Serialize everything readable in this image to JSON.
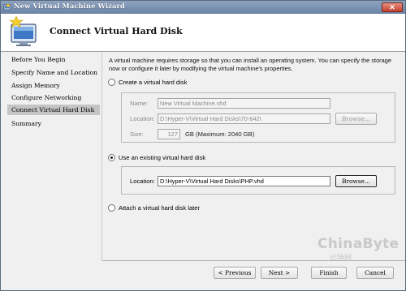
{
  "window": {
    "title": "New Virtual Machine Wizard",
    "close_label": "✕"
  },
  "header": {
    "page_title": "Connect Virtual Hard Disk"
  },
  "nav": {
    "items": [
      {
        "label": "Before You Begin",
        "selected": false
      },
      {
        "label": "Specify Name and Location",
        "selected": false
      },
      {
        "label": "Assign Memory",
        "selected": false
      },
      {
        "label": "Configure Networking",
        "selected": false
      },
      {
        "label": "Connect Virtual Hard Disk",
        "selected": true
      },
      {
        "label": "Summary",
        "selected": false
      }
    ]
  },
  "content": {
    "intro": "A virtual machine requires storage so that you can install an operating system. You can specify the storage now or configure it later by modifying the virtual machine's properties.",
    "option_create": {
      "label": "Create a virtual hard disk",
      "checked": false,
      "name_label": "Name:",
      "name_value": "New Virtual Machine.vhd",
      "location_label": "Location:",
      "location_value": "D:\\Hyper-V\\Virtual Hard Disks\\70-642\\",
      "browse_label": "Browse...",
      "size_label": "Size:",
      "size_value": "127",
      "size_suffix": "GB (Maximum: 2040 GB)"
    },
    "option_existing": {
      "label": "Use an existing virtual hard disk",
      "checked": true,
      "location_label": "Location:",
      "location_value": "D:\\Hyper-V\\Virtual Hard Disks\\PHP.vhd",
      "browse_label": "Browse..."
    },
    "option_later": {
      "label": "Attach a virtual hard disk later",
      "checked": false
    }
  },
  "footer": {
    "previous_label": "< Previous",
    "next_label": "Next >",
    "finish_label": "Finish",
    "cancel_label": "Cancel"
  },
  "watermark": {
    "brand": "ChinaByte",
    "sub": "比特网"
  },
  "colors": {
    "titlebar": "#7a91b4",
    "selected_nav": "#c4c4c4",
    "dialog_bg": "#f0f0f0"
  }
}
